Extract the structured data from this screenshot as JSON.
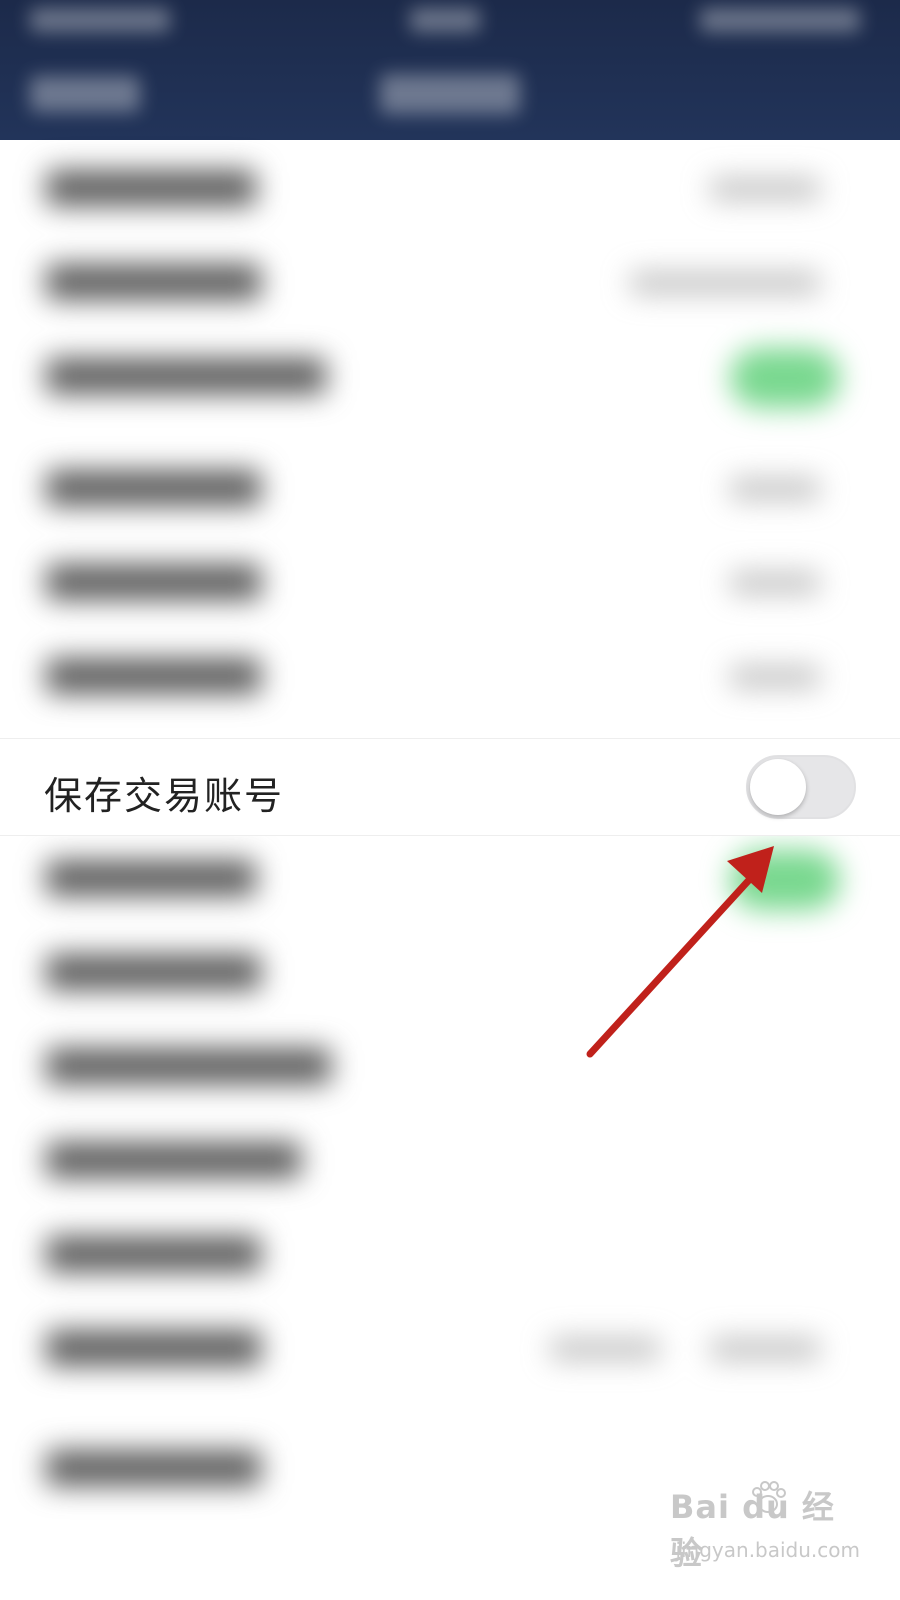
{
  "settings": {
    "save_trading_account": {
      "label": "保存交易账号",
      "enabled": false
    }
  },
  "colors": {
    "header_bg": "#1c2a4a",
    "toggle_on": "#4ccb6a",
    "toggle_off": "#e6e6e8",
    "annotation_arrow": "#c0211b"
  },
  "watermark": {
    "logo": "Bai du 经验",
    "url": "jingyan.baidu.com"
  }
}
